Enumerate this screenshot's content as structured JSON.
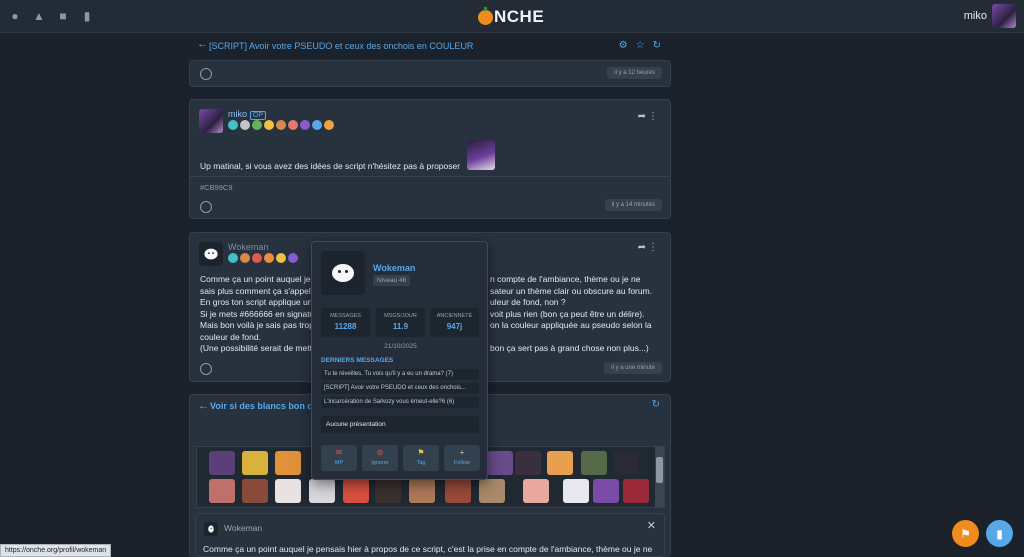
{
  "site": {
    "logo_text": "NCHE",
    "username": "miko"
  },
  "topic": {
    "title": "[SCRIPT] Avoir votre PSEUDO et ceux des onchois en COULEUR"
  },
  "posts": [
    {
      "time": "il y a 12 heures"
    },
    {
      "author": "miko",
      "op_badge": "OP",
      "text": "Up matinal, si vous avez des idées de script n'hésitez pas à proposer",
      "signature": "#CB99C9",
      "time": "il y a 14 minutes"
    },
    {
      "author": "Wokeman",
      "lines": [
        "Comme ça un point auquel je",
        "sais plus comment ça s'appell",
        "En gros ton script applique un",
        "Si je mets #666666 en signatu",
        "Mais bon voilà je sais pas trop",
        "couleur de fond.",
        "(Une possibilité serait de mett"
      ],
      "lines_right": [
        "n compte de l'ambiance, thème ou je ne",
        "sateur un thème clair ou obscure au forum.",
        "uleur de fond, non ?",
        "voit plus rien (bon ça peut être un délire).",
        "on la couleur appliquée au pseudo selon la",
        "",
        "bon ça sert pas à grand chose non plus...)"
      ],
      "time": "il y a une minute"
    }
  ],
  "second_topic": {
    "title": "Voir si des blancs bon délir"
  },
  "popup": {
    "name": "Wokeman",
    "level": "Niveau 46",
    "stats": [
      {
        "label": "MESSAGES",
        "value": "11288"
      },
      {
        "label": "MSGS/JOUR",
        "value": "11.9"
      },
      {
        "label": "ANCIENNETÉ",
        "value": "947j"
      }
    ],
    "date": "21/10/2025",
    "section_title": "DERNIERS MESSAGES",
    "last_messages": [
      "Tu te réveilles. Tu vois qu'il y a eu un drama? (7)",
      "[SCRIPT] Avoir votre PSEUDO et ceux des onchois...",
      "L'incarcération de Sarkozy vous émeut-elle?6 (6)"
    ],
    "presentation": "Aucune présentation",
    "actions": [
      {
        "label": "MP",
        "icon": "mail-icon"
      },
      {
        "label": "Ignorer",
        "icon": "block-icon"
      },
      {
        "label": "Tag",
        "icon": "tag-icon"
      },
      {
        "label": "Follow",
        "icon": "plus-icon"
      }
    ]
  },
  "reply": {
    "author": "Wokeman",
    "text": "Comme ça un point auquel je pensais hier à propos de ce script, c'est la prise en compte de l'ambiance, thème ou je ne"
  },
  "status_url": "https://onche.org/profil/wokeman",
  "colors": {
    "accent": "#58a8e8",
    "background": "#1b222c",
    "card": "#28323f"
  }
}
